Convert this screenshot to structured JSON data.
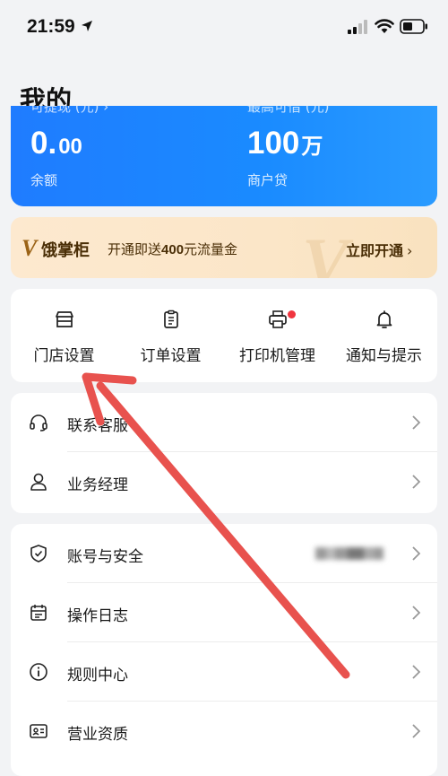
{
  "status_bar": {
    "time": "21:59"
  },
  "page": {
    "title": "我的"
  },
  "balance_card": {
    "left": {
      "header": "可提现 (元) ›",
      "value_main": "0.",
      "value_small": "00",
      "label": "余额"
    },
    "right": {
      "header": "最高可借 (元)",
      "value_main": "100",
      "value_unit": "万",
      "label": "商户贷"
    }
  },
  "promo": {
    "logo_mark": "V",
    "brand": "饿掌柜",
    "text_prefix": "开通即送",
    "text_amount": "400",
    "text_suffix": "元流量金",
    "cta": "立即开通",
    "cta_chevron": "›"
  },
  "quick_actions": [
    {
      "label": "门店设置",
      "icon": "store-icon"
    },
    {
      "label": "订单设置",
      "icon": "clipboard-icon"
    },
    {
      "label": "打印机管理",
      "icon": "printer-icon",
      "badge": "red-dot"
    },
    {
      "label": "通知与提示",
      "icon": "bell-icon"
    }
  ],
  "list_group_1": [
    {
      "label": "联系客服",
      "icon": "headset-icon"
    },
    {
      "label": "业务经理",
      "icon": "person-icon"
    }
  ],
  "list_group_2": [
    {
      "label": "账号与安全",
      "icon": "shield-icon"
    },
    {
      "label": "操作日志",
      "icon": "calendar-icon"
    },
    {
      "label": "规则中心",
      "icon": "info-icon"
    },
    {
      "label": "营业资质",
      "icon": "id-card-icon"
    }
  ],
  "colors": {
    "accent_blue": "#1f7cff",
    "promo_bg": "#fde9cf",
    "badge_red": "#f0353f",
    "annotation_arrow": "#e8524e"
  }
}
